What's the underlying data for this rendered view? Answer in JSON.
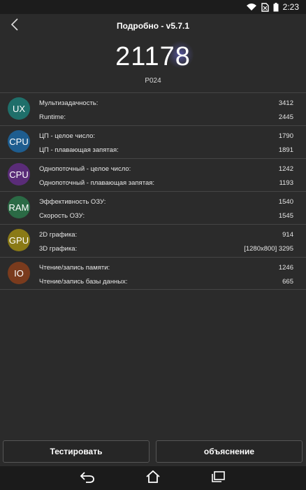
{
  "status": {
    "time": "2:23"
  },
  "header": {
    "title": "Подробно - v5.7.1"
  },
  "score": {
    "value": "21178",
    "device": "P024"
  },
  "rows": [
    {
      "badge": "UX",
      "color": "#1f6f6a",
      "items": [
        {
          "label": "Мультизадачность:",
          "value": "3412"
        },
        {
          "label": "Runtime:",
          "value": "2445"
        }
      ]
    },
    {
      "badge": "CPU",
      "color": "#1e5d8f",
      "items": [
        {
          "label": "ЦП - целое число:",
          "value": "1790"
        },
        {
          "label": "ЦП - плавающая запятая:",
          "value": "1891"
        }
      ]
    },
    {
      "badge": "CPU",
      "color": "#5a2c78",
      "items": [
        {
          "label": "Однопоточный - целое число:",
          "value": "1242"
        },
        {
          "label": "Однопоточный - плавающая запятая:",
          "value": "1193"
        }
      ]
    },
    {
      "badge": "RAM",
      "color": "#2b6a45",
      "items": [
        {
          "label": "Эффективность ОЗУ:",
          "value": "1540"
        },
        {
          "label": "Скорость ОЗУ:",
          "value": "1545"
        }
      ]
    },
    {
      "badge": "GPU",
      "color": "#8a7a16",
      "items": [
        {
          "label": "2D графика:",
          "value": "914"
        },
        {
          "label": "3D графика:",
          "value": "[1280x800] 3295"
        }
      ]
    },
    {
      "badge": "IO",
      "color": "#7a3b1d",
      "items": [
        {
          "label": "Чтение/запись памяти:",
          "value": "1246"
        },
        {
          "label": "Чтение/запись базы данных:",
          "value": "665"
        }
      ]
    }
  ],
  "buttons": {
    "test": "Тестировать",
    "explain": "объяснение"
  },
  "icons": {
    "status": [
      "wifi-icon",
      "sim-no-signal-icon",
      "battery-icon"
    ],
    "back": "chevron-left-icon",
    "nav": [
      "back-arrow-icon",
      "home-icon",
      "recent-apps-icon"
    ]
  }
}
